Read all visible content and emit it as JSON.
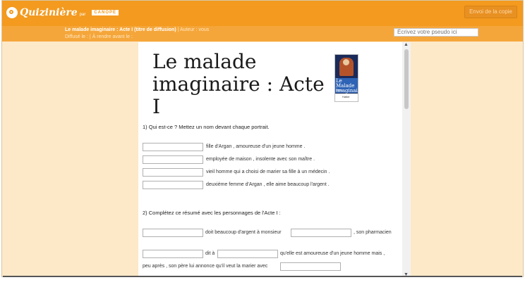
{
  "header": {
    "logo_text": "Quizinière",
    "logo_suffix": "par",
    "logo_brand": "CANOPÉ",
    "send_button": "Envoi de la copie"
  },
  "info": {
    "title": "Le malade imaginaire : Acte I (titre de diffusion)",
    "separator1": "|",
    "author": "Auteur : vous",
    "diffused": "Diffusé le :",
    "separator2": "|",
    "due": "À rendre avant le :"
  },
  "pseudo": {
    "placeholder": "Écrivez votre pseudo ici"
  },
  "document": {
    "title": "Le malade imaginaire : Acte I",
    "cover": {
      "title": "Le Malade imaginaire",
      "subtitle": "Molière",
      "publisher": "Hatier"
    },
    "q1": {
      "title": "1) Qui est-ce ? Mettez un nom devant chaque portrait.",
      "items": [
        "fille d'Argan , amoureuse d'un jeune homme .",
        "employée de maison , insolente avec son maître .",
        "vieil homme qui a choisi de marier sa fille à un médecin .",
        "deuxième femme d'Argan , elle aime beaucoup l'argent ."
      ]
    },
    "q2": {
      "title": "2) Complétez ce résumé avec les personnages de l'Acte I :",
      "line1_a": "doit beaucoup d'argent à monsieur",
      "line1_b": ", son pharmacien",
      "line2_a": "dit à",
      "line2_b": "qu'elle est amoureuse d'un jeune homme mais ,",
      "line3_a": "peu après , son père lui annonce qu'il veut la marier avec"
    }
  }
}
